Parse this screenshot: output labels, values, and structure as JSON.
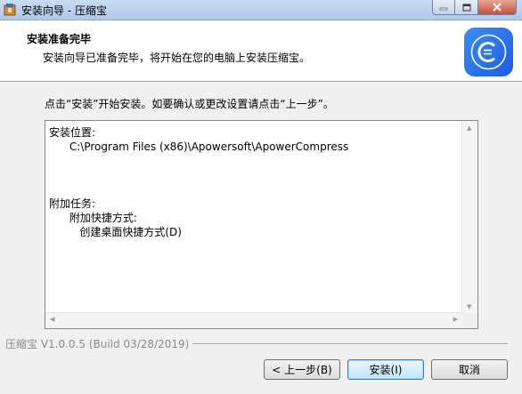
{
  "window": {
    "title": "安装向导 - 压缩宝"
  },
  "header": {
    "title": "安装准备完毕",
    "subtitle": "安装向导已准备完毕，将开始在您的电脑上安装压缩宝。"
  },
  "instruction": "点击“安装”开始安装。如要确认或更改设置请点击“上一步”。",
  "memo": {
    "content": "安装位置:\n      C:\\Program Files (x86)\\Apowersoft\\ApowerCompress\n\n\n\n附加任务:\n      附加快捷方式:\n         创建桌面快捷方式(D)"
  },
  "version": "压缩宝 V1.0.0.5 (Build 03/28/2019)",
  "buttons": {
    "back": "< 上一步(B)",
    "install": "安装(I)",
    "cancel": "取消"
  },
  "colors": {
    "logo": "#2a74ee",
    "titlebar": "#b9d1ee",
    "close_button": "#c7503b"
  }
}
